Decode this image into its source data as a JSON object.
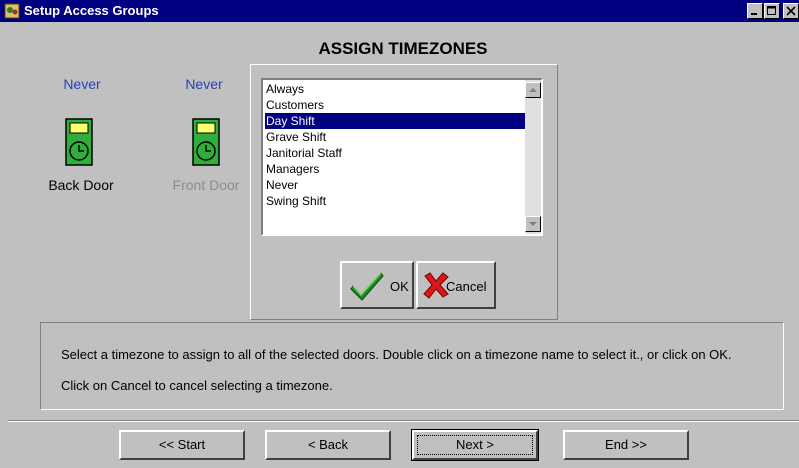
{
  "window": {
    "title": "Setup Access Groups"
  },
  "heading": "ASSIGN TIMEZONES",
  "doors": [
    {
      "status": "Never",
      "label": "Back Door",
      "active": true
    },
    {
      "status": "Never",
      "label": "Front Door",
      "active": false
    }
  ],
  "timezones": {
    "items": [
      "Always",
      "Customers",
      "Day Shift",
      "Grave Shift",
      "Janitorial Staff",
      "Managers",
      "Never",
      "Swing Shift"
    ],
    "selected": "Day Shift"
  },
  "buttons": {
    "ok": "OK",
    "cancel": "Cancel"
  },
  "instructions": {
    "line1": "Select a timezone to assign to all of the selected doors. Double click on a timezone name to select it., or click on OK.",
    "line2": "Click on Cancel to cancel selecting a timezone."
  },
  "nav": {
    "start": "<< Start",
    "back": "< Back",
    "next": "Next >",
    "end": "End >>"
  },
  "colors": {
    "title_bar": "#000080",
    "selection": "#000080",
    "door_status": "#2b3fb4",
    "inactive_label": "#8c8c8c",
    "window_bg": "#c0c0c0"
  }
}
